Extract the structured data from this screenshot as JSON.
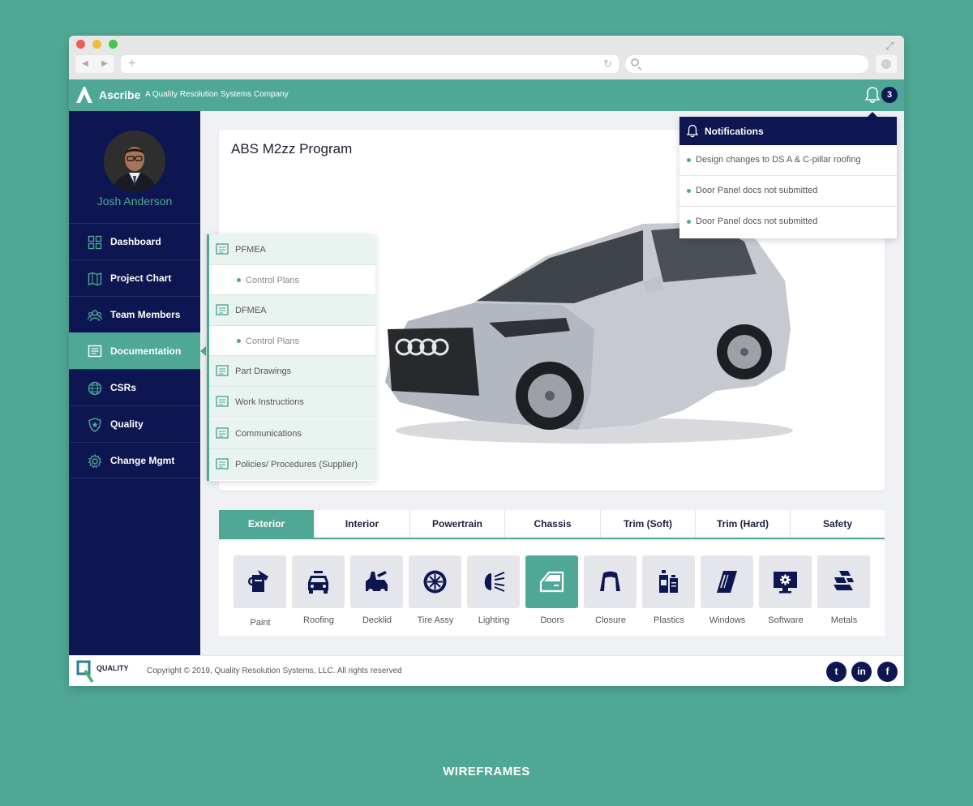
{
  "header": {
    "brand": "Ascribe",
    "tagline": "A Quality Resolution Systems Company",
    "notification_count": "3"
  },
  "user": {
    "name": "Josh Anderson"
  },
  "sidebar": {
    "items": [
      {
        "label": "Dashboard",
        "icon": "grid-icon"
      },
      {
        "label": "Project Chart",
        "icon": "map-icon"
      },
      {
        "label": "Team Members",
        "icon": "team-icon"
      },
      {
        "label": "Documentation",
        "icon": "document-icon",
        "active": true
      },
      {
        "label": "CSRs",
        "icon": "globe-icon"
      },
      {
        "label": "Quality",
        "icon": "shield-star-icon"
      },
      {
        "label": "Change Mgmt",
        "icon": "gear-icon"
      }
    ]
  },
  "documentation_menu": {
    "items": [
      {
        "label": "PFMEA",
        "type": "main"
      },
      {
        "label": "Control Plans",
        "type": "sub"
      },
      {
        "label": "DFMEA",
        "type": "main"
      },
      {
        "label": "Control Plans",
        "type": "sub"
      },
      {
        "label": "Part Drawings",
        "type": "main"
      },
      {
        "label": "Work Instructions",
        "type": "main"
      },
      {
        "label": "Communications",
        "type": "main"
      },
      {
        "label": "Policies/ Procedures (Supplier)",
        "type": "main"
      }
    ]
  },
  "program": {
    "title": "ABS M2zz Program"
  },
  "notifications": {
    "title": "Notifications",
    "items": [
      "Design changes to DS A & C-pillar roofing",
      "Door Panel docs not submitted",
      "Door Panel docs not submitted"
    ]
  },
  "categories": {
    "tabs": [
      "Exterior",
      "Interior",
      "Powertrain",
      "Chassis",
      "Trim (Soft)",
      "Trim (Hard)",
      "Safety"
    ],
    "active_tab": "Exterior",
    "parts": [
      {
        "label": "Paint",
        "icon": "paint-bucket-icon"
      },
      {
        "label": "Roofing",
        "icon": "car-roof-icon"
      },
      {
        "label": "Decklid",
        "icon": "decklid-icon"
      },
      {
        "label": "Tire Assy",
        "icon": "wheel-icon"
      },
      {
        "label": "Lighting",
        "icon": "headlight-icon"
      },
      {
        "label": "Doors",
        "icon": "car-door-icon",
        "active": true
      },
      {
        "label": "Closure",
        "icon": "closure-icon"
      },
      {
        "label": "Plastics",
        "icon": "plastic-bottles-icon"
      },
      {
        "label": "Windows",
        "icon": "window-glass-icon"
      },
      {
        "label": "Software",
        "icon": "monitor-gear-icon"
      },
      {
        "label": "Metals",
        "icon": "metal-bars-icon"
      }
    ]
  },
  "footer": {
    "logo_text": "QUALITY",
    "copyright": "Copyright © 2019, Quality Resolution Systems, LLC. All rights reserved",
    "social": [
      {
        "name": "twitter-icon",
        "glyph": "t"
      },
      {
        "name": "linkedin-icon",
        "glyph": "in"
      },
      {
        "name": "facebook-icon",
        "glyph": "f"
      }
    ]
  },
  "caption": "WIREFRAMES",
  "colors": {
    "teal": "#4fa895",
    "navy": "#0d1650",
    "content_bg": "#eff1f4",
    "tile_bg": "#e5e6ec"
  }
}
